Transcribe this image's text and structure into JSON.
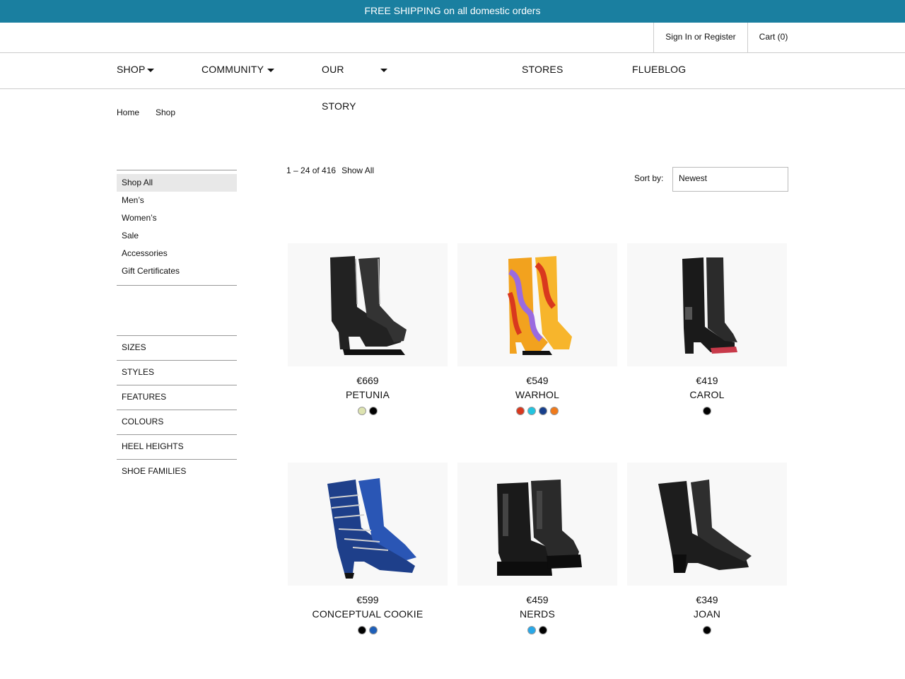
{
  "promo": {
    "text": "FREE SHIPPING on all domestic orders"
  },
  "account": {
    "signin_label": "Sign In or Register",
    "cart_label": "Cart (0)"
  },
  "nav": {
    "shop": "SHOP",
    "community": "COMMUNITY",
    "our": "OUR",
    "story": "STORY",
    "stores": "STORES",
    "flueblog": "FLUEBLOG"
  },
  "breadcrumb": {
    "home": "Home",
    "shop": "Shop"
  },
  "sidebar": {
    "categories": [
      "Shop All",
      "Men’s",
      "Women’s",
      "Sale",
      "Accessories",
      "Gift Certificates"
    ],
    "filters": [
      "SIZES",
      "STYLES",
      "FEATURES",
      "COLOURS",
      "HEEL HEIGHTS",
      "SHOE FAMILIES"
    ]
  },
  "listing": {
    "count_text": "1 – 24 of 416",
    "show_all": "Show All",
    "sort_label": "Sort by:",
    "sort_value": "Newest"
  },
  "products": [
    {
      "price": "€669",
      "name": "PETUNIA",
      "swatches": [
        "#dde3b0",
        "#000000"
      ],
      "icon": "platform-zip-boot"
    },
    {
      "price": "€549",
      "name": "WARHOL",
      "swatches": [
        "#d9381e",
        "#22c4e0",
        "#173f8c",
        "#f07a1a"
      ],
      "icon": "colorful-tall-boot"
    },
    {
      "price": "€419",
      "name": "CAROL",
      "swatches": [
        "#000000"
      ],
      "icon": "black-riding-boot"
    },
    {
      "price": "€599",
      "name": "CONCEPTUAL COOKIE",
      "swatches": [
        "#000000",
        "#1e5fb8"
      ],
      "icon": "blue-buckle-boot"
    },
    {
      "price": "€459",
      "name": "NERDS",
      "swatches": [
        "#29a8e8",
        "#000000"
      ],
      "icon": "chelsea-platform-boot"
    },
    {
      "price": "€349",
      "name": "JOAN",
      "swatches": [
        "#000000"
      ],
      "icon": "black-ankle-boot"
    }
  ]
}
